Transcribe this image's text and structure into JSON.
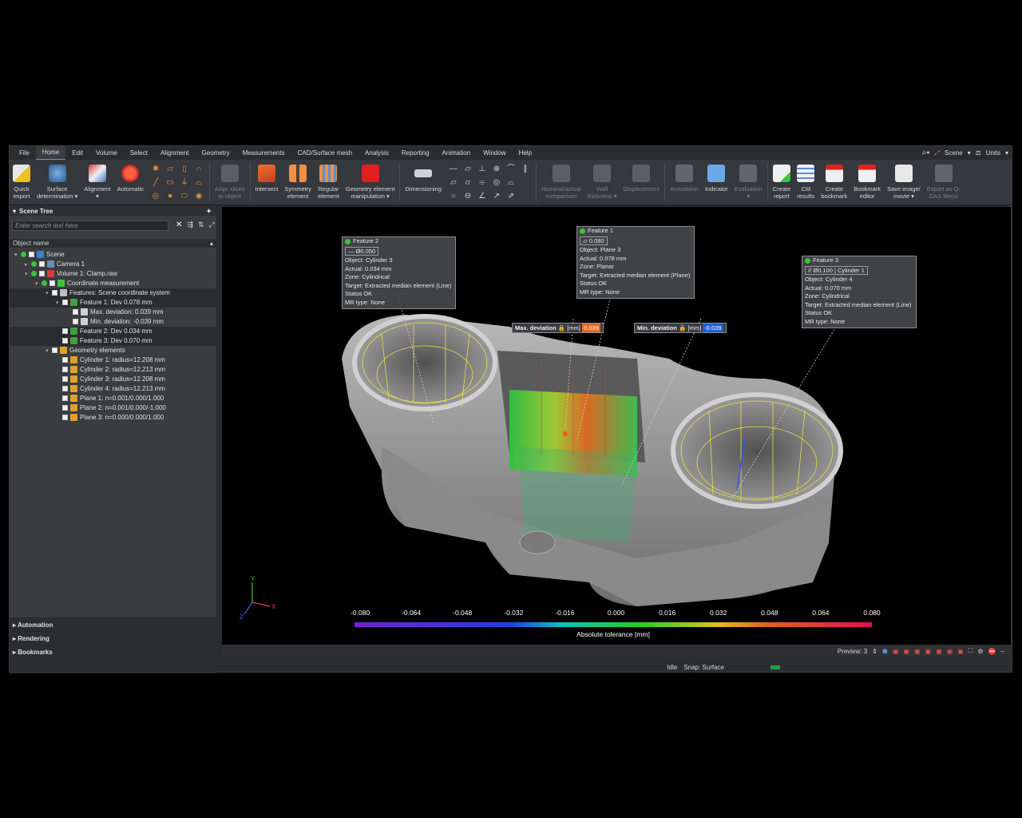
{
  "menu": [
    "File",
    "Home",
    "Edit",
    "Volume",
    "Select",
    "Alignment",
    "Geometry",
    "Measurements",
    "CAD/Surface mesh",
    "Analysis",
    "Reporting",
    "Animation",
    "Window",
    "Help"
  ],
  "menu_right": {
    "scene": "Scene",
    "units": "Units"
  },
  "ribbon": {
    "quick_import": "Quick\nimport",
    "surface_determination": "Surface\ndetermination ▾",
    "alignment": "Alignment\n▾",
    "automatic": "Automatic",
    "align_slices": "Align slices\nto object",
    "intersect": "Intersect",
    "symmetry": "Symmetry\nelement",
    "regular": "Regular\nelement",
    "geom_manip": "Geometry element\nmanipulation ▾",
    "dimensioning": "Dimensioning",
    "nominal_actual": "Nominal/actual\ncomparison",
    "wall_thickness": "Wall\nthickness ▾",
    "displacement": "Displacement",
    "annotation": "Annotation",
    "indicator": "Indicator",
    "evaluation": "Evaluation\n▾",
    "create_report": "Create\nreport",
    "cm_results": "CM\nresults",
    "create_bookmark": "Create\nbookmark",
    "bookmark_editor": "Bookmark\neditor",
    "save_image": "Save image/\nmovie ▾",
    "export_qdas": "Export as Q-\nDAS file(s)"
  },
  "panel": {
    "title": "Scene Tree",
    "search_placeholder": "Enter search text here",
    "column": "Object name",
    "tree": [
      {
        "label": "Scene",
        "indent": 0
      },
      {
        "label": "Camera 1",
        "indent": 1
      },
      {
        "label": "Volume 1: Clamp.raw",
        "indent": 1
      },
      {
        "label": "Coordinate measurement",
        "indent": 2
      },
      {
        "label": "Features: Scene coordinate system",
        "indent": 3
      },
      {
        "label": "Feature 1: Dev 0.078 mm",
        "indent": 4
      },
      {
        "label": "Max. deviation: 0.039 mm",
        "indent": 5
      },
      {
        "label": "Min. deviation: -0.039 mm",
        "indent": 5
      },
      {
        "label": "Feature 2: Dev 0.034 mm",
        "indent": 4
      },
      {
        "label": "Feature 3: Dev 0.070 mm",
        "indent": 4
      },
      {
        "label": "Geometry elements",
        "indent": 3
      },
      {
        "label": "Cylinder 1: radius=12.208 mm",
        "indent": 4
      },
      {
        "label": "Cylinder 2: radius=12.213 mm",
        "indent": 4
      },
      {
        "label": "Cylinder 3: radius=12.208 mm",
        "indent": 4
      },
      {
        "label": "Cylinder 4: radius=12.213 mm",
        "indent": 4
      },
      {
        "label": "Plane 1: n=0.001/0.000/1.000",
        "indent": 4
      },
      {
        "label": "Plane 2: n=0.001/0.000/-1.000",
        "indent": 4
      },
      {
        "label": "Plane 3: n=0.000/0.000/1.000",
        "indent": 4
      }
    ]
  },
  "accordion": [
    "Automation",
    "Rendering",
    "Bookmarks"
  ],
  "callouts": {
    "f2": {
      "title": "Feature 2",
      "tol": "Ø0.050",
      "l1": "Object:  Cylinder 3",
      "l2": "Actual:  0.034 mm",
      "l3": "Zone:    Cylindrical",
      "l4": "Target:  Extracted median element (Line)",
      "l5": "Status    OK",
      "l6": "MR type: None"
    },
    "f1": {
      "title": "Feature 1",
      "tol": "0.080",
      "l1": "Object:  Plane 3",
      "l2": "Actual:  0.078 mm",
      "l3": "Zone:    Planar",
      "l4": "Target:  Extracted median element (Plane)",
      "l5": "Status    OK",
      "l6": "MR type: None"
    },
    "f3": {
      "title": "Feature 3",
      "tol": "Ø0.100",
      "tol2": "Cylinder 1",
      "l1": "Object:  Cylinder 4",
      "l2": "Actual:  0.070 mm",
      "l3": "Zone:    Cylindrical",
      "l4": "Target:  Extracted median element (Line)",
      "l5": "Status    OK",
      "l6": "MR type: None"
    }
  },
  "deviation": {
    "max_label": "Max. deviation",
    "max_unit": "[mm]",
    "max_val": "0.039",
    "min_label": "Min. deviation",
    "min_unit": "[mm]",
    "min_val": "-0.039"
  },
  "scale": {
    "ticks": [
      "-0.080",
      "-0.064",
      "-0.048",
      "-0.032",
      "-0.016",
      "0.000",
      "0.016",
      "0.032",
      "0.048",
      "0.064",
      "0.080"
    ],
    "title": "Absolute tolerance [mm]"
  },
  "axes": {
    "x": "X",
    "y": "Y",
    "z": "Z"
  },
  "bottom": {
    "preview": "Preview: 3"
  },
  "status": {
    "state": "Idle",
    "snap": "Snap: Surface"
  }
}
